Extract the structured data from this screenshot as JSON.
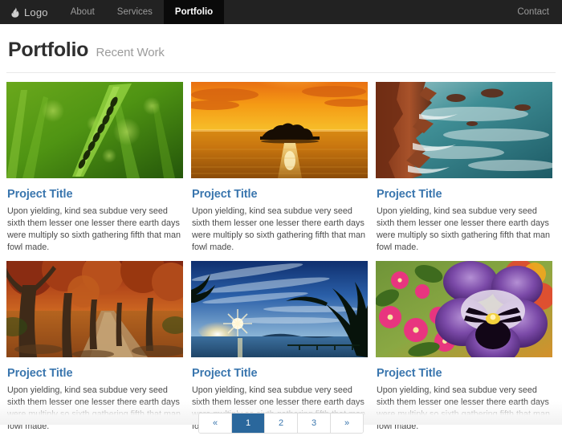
{
  "navbar": {
    "brand": {
      "label": "Logo",
      "icon": "flame-icon"
    },
    "items": [
      {
        "label": "About",
        "active": false
      },
      {
        "label": "Services",
        "active": false
      },
      {
        "label": "Portfolio",
        "active": true
      }
    ],
    "right_items": [
      {
        "label": "Contact",
        "active": false
      }
    ],
    "background_color": "#222222",
    "active_background_color": "#0a0a0a"
  },
  "header": {
    "title": "Portfolio",
    "subtitle": "Recent Work"
  },
  "theme": {
    "link_color": "#3a76ae",
    "text_color": "#4b4b4b",
    "title_color": "#2f2f2f",
    "subtitle_color": "#9b9b9b",
    "divider_color": "#e8e8e8",
    "pagination_active_color": "#2a679c"
  },
  "cards": [
    {
      "title": "Project Title",
      "text": "Upon yielding, kind sea subdue very seed sixth them lesser one lesser there earth days were multiply so sixth gathering fifth that man fowl made.",
      "image": "green-grass-with-ants-photo"
    },
    {
      "title": "Project Title",
      "text": "Upon yielding, kind sea subdue very seed sixth them lesser one lesser there earth days were multiply so sixth gathering fifth that man fowl made.",
      "image": "orange-sunset-over-lake-island-photo"
    },
    {
      "title": "Project Title",
      "text": "Upon yielding, kind sea subdue very seed sixth them lesser one lesser there earth days were multiply so sixth gathering fifth that man fowl made.",
      "image": "rocky-coast-teal-ocean-photo"
    },
    {
      "title": "Project Title",
      "text": "Upon yielding, kind sea subdue very seed sixth them lesser one lesser there earth days were multiply so sixth gathering fifth that man fowl made.",
      "image": "autumn-trees-pathway-photo"
    },
    {
      "title": "Project Title",
      "text": "Upon yielding, kind sea subdue very seed sixth them lesser one lesser there earth days were multiply so sixth gathering fifth that man fowl made.",
      "image": "tropical-beach-palm-sunset-photo"
    },
    {
      "title": "Project Title",
      "text": "Upon yielding, kind sea subdue very seed sixth them lesser one lesser there earth days were multiply so sixth gathering fifth that man fowl made.",
      "image": "purple-pansy-flower-photo"
    }
  ],
  "pagination": {
    "pages": [
      {
        "label": "«",
        "active": false
      },
      {
        "label": "1",
        "active": true
      },
      {
        "label": "2",
        "active": false
      },
      {
        "label": "3",
        "active": false
      },
      {
        "label": "»",
        "active": false
      }
    ]
  }
}
